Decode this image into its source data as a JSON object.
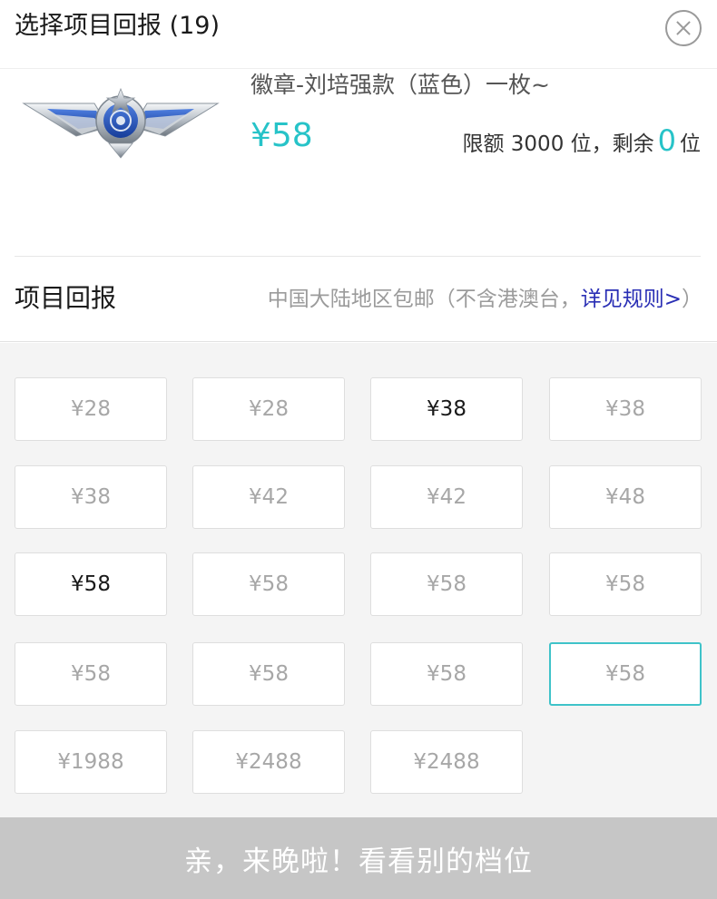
{
  "header": {
    "title": "选择项目回报 (19)"
  },
  "product": {
    "name": "徽章-刘培强款（蓝色）一枚~",
    "price": "¥58",
    "quota_prefix": "限额 3000 位，剩余",
    "remaining": "0",
    "quota_suffix": "位"
  },
  "section": {
    "title": "项目回报",
    "shipping_note": "中国大陆地区包邮（不含港澳台，",
    "rules_link": "详见规则>",
    "shipping_close": "）"
  },
  "tiers": [
    {
      "label": "¥28",
      "state": "disabled"
    },
    {
      "label": "¥28",
      "state": "disabled"
    },
    {
      "label": "¥38",
      "state": "available"
    },
    {
      "label": "¥38",
      "state": "disabled"
    },
    {
      "label": "¥38",
      "state": "disabled"
    },
    {
      "label": "¥42",
      "state": "disabled"
    },
    {
      "label": "¥42",
      "state": "disabled"
    },
    {
      "label": "¥48",
      "state": "disabled"
    },
    {
      "label": "¥58",
      "state": "available"
    },
    {
      "label": "¥58",
      "state": "disabled"
    },
    {
      "label": "¥58",
      "state": "disabled"
    },
    {
      "label": "¥58",
      "state": "disabled"
    },
    {
      "label": "¥58",
      "state": "disabled"
    },
    {
      "label": "¥58",
      "state": "disabled"
    },
    {
      "label": "¥58",
      "state": "disabled"
    },
    {
      "label": "¥58",
      "state": "selected"
    },
    {
      "label": "¥1988",
      "state": "disabled"
    },
    {
      "label": "¥2488",
      "state": "disabled"
    },
    {
      "label": "¥2488",
      "state": "disabled"
    }
  ],
  "footer": {
    "label": "亲，来晚啦！看看别的档位"
  },
  "colors": {
    "accent": "#27c3c8",
    "link": "#2a2fb5",
    "footer_disabled": "#c6c6c6"
  }
}
